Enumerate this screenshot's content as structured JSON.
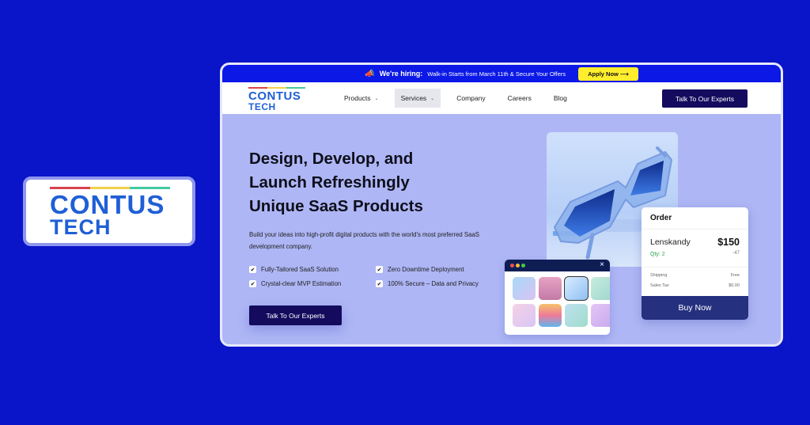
{
  "brand": {
    "line1": "CONTUS",
    "line2": "TECH",
    "bar_colors": [
      "#d8434f",
      "#f2d04a",
      "#43c9a0"
    ],
    "text_color": "#1f5fd6"
  },
  "announcement": {
    "icon": "megaphone-icon",
    "label": "We're hiring:",
    "text": "Walk-in Starts from March 11th & Secure Your Offers",
    "button": "Apply Now ⟶"
  },
  "nav": {
    "items": [
      {
        "label": "Products",
        "has_dropdown": true
      },
      {
        "label": "Services",
        "has_dropdown": true,
        "active": true
      },
      {
        "label": "Company"
      },
      {
        "label": "Careers"
      },
      {
        "label": "Blog"
      }
    ],
    "cta": "Talk To Our Experts"
  },
  "hero": {
    "title_lines": [
      "Design, Develop, and",
      "Launch Refreshingly",
      "Unique SaaS Products"
    ],
    "subtitle": "Build your ideas into high-profit digital products with the world's most preferred SaaS development company.",
    "features": [
      "Fully-Tailored SaaS Solution",
      "Zero Downtime Deployment",
      "Crystal-clear MVP Estimation",
      "100% Secure – Data and Privacy"
    ],
    "cta": "Talk To Our Experts"
  },
  "gallery": {
    "close_icon": "×",
    "selected_index": 2
  },
  "order": {
    "title": "Order",
    "product": "Lenskandy",
    "price": "$150",
    "qty": "Qty: 2",
    "discount": "-47",
    "shipping_label": "Shipping",
    "shipping_value": "Free",
    "tax_label": "Sales Tax",
    "tax_value": "$0.00",
    "button": "Buy Now"
  },
  "colors": {
    "background": "#0a14c8",
    "announcement_bar": "#0b18e6",
    "cta": "#140b5e",
    "apply": "#ffee2e",
    "hero_bg": "#aeb6f5",
    "buy_now": "#25317f"
  }
}
